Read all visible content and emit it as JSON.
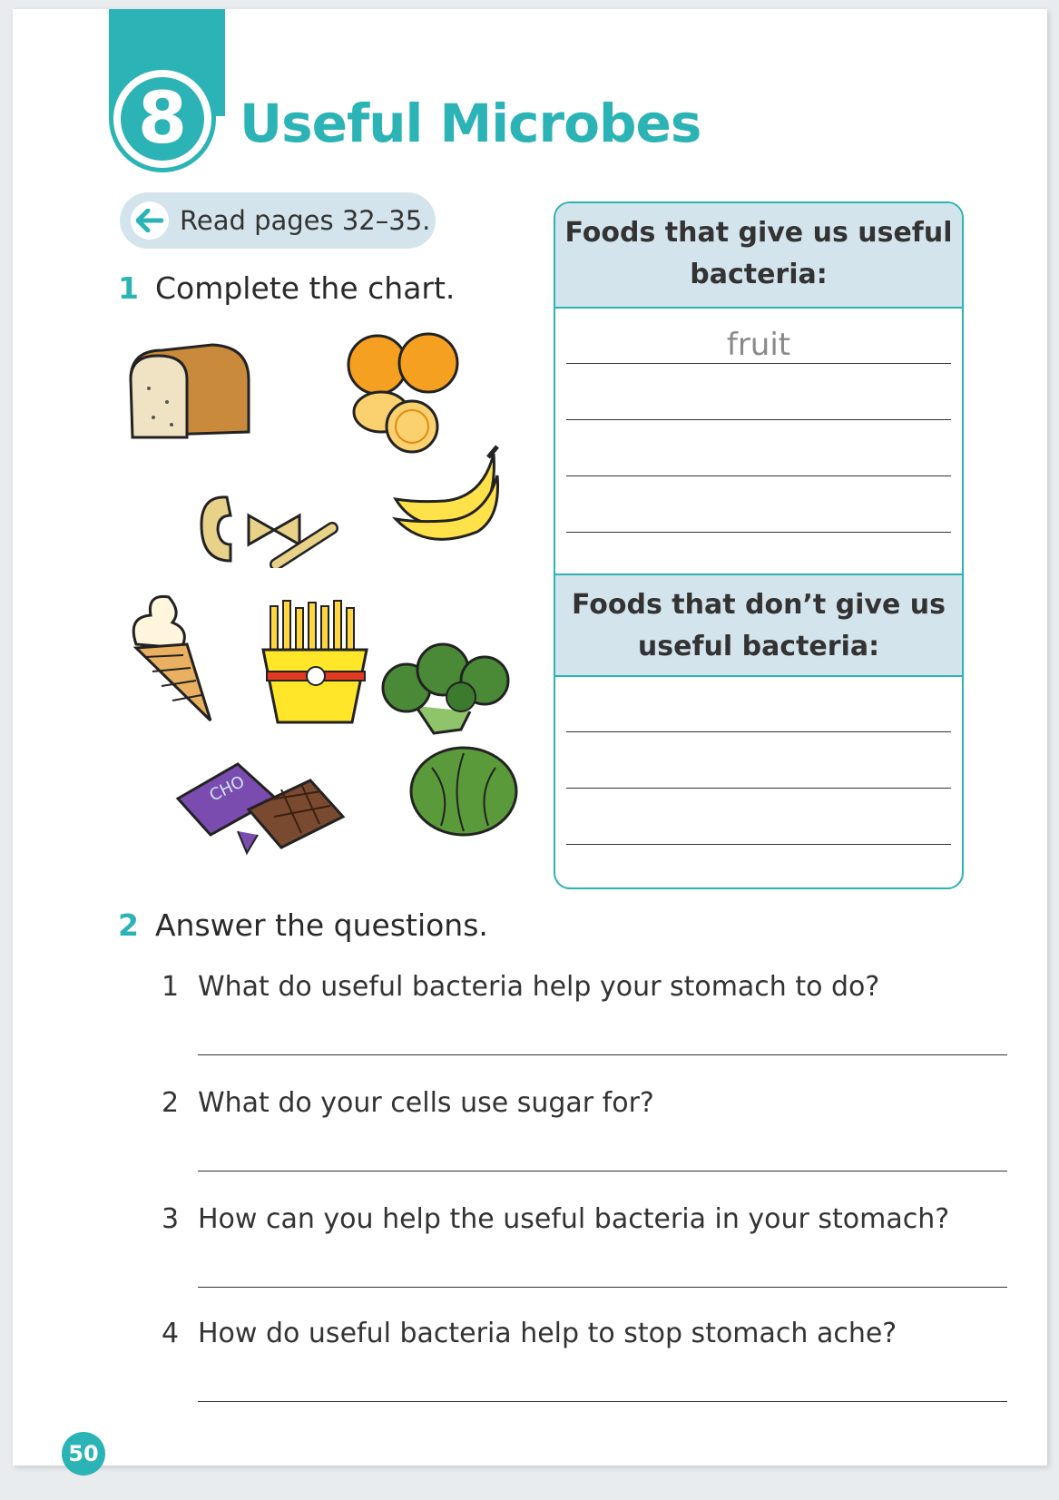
{
  "chapter": {
    "number": "8",
    "title": "Useful Microbes"
  },
  "reading": {
    "label": "Read pages 32–35."
  },
  "exercise1": {
    "number": "1",
    "instruction": "Complete the chart."
  },
  "chart": {
    "header1": "Foods that give us useful bacteria:",
    "example_answer": "fruit",
    "header2": "Foods that don’t give us useful bacteria:"
  },
  "foods_illustrated": [
    "bread-icon",
    "oranges-icon",
    "pasta-icon",
    "bananas-icon",
    "ice-cream-icon",
    "fries-icon",
    "broccoli-icon",
    "chocolate-icon",
    "lettuce-icon"
  ],
  "chocolate_wrapper_text": "CHO",
  "exercise2": {
    "number": "2",
    "instruction": "Answer the questions.",
    "questions": [
      {
        "n": "1",
        "text": "What do useful bacteria help your stomach to do?"
      },
      {
        "n": "2",
        "text": "What do your cells use sugar for?"
      },
      {
        "n": "3",
        "text": "How can you help the useful bacteria in your stomach?"
      },
      {
        "n": "4",
        "text": "How do useful bacteria help to stop stomach ache?"
      }
    ]
  },
  "page_number": "50",
  "colors": {
    "accent": "#2bb3b5",
    "header_bg": "#d4e4ec"
  }
}
